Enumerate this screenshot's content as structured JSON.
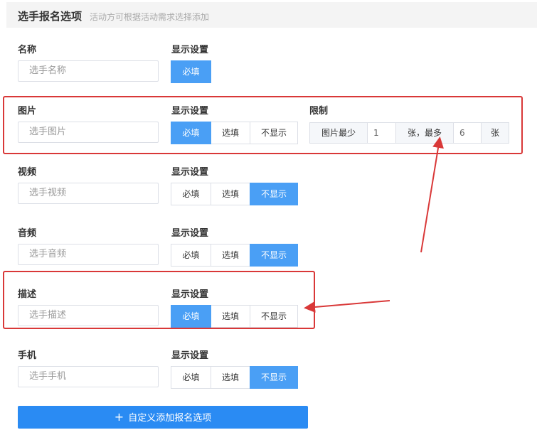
{
  "header": {
    "title": "选手报名选项",
    "subtitle": "活动方可根据活动需求选择添加"
  },
  "setting_label": "显示设置",
  "fields": [
    {
      "label": "名称",
      "placeholder": "选手名称",
      "options": [
        "必填"
      ],
      "selected": "必填"
    },
    {
      "label": "图片",
      "placeholder": "选手图片",
      "options": [
        "必填",
        "选填",
        "不显示"
      ],
      "selected": "必填"
    },
    {
      "label": "视频",
      "placeholder": "选手视频",
      "options": [
        "必填",
        "选填",
        "不显示"
      ],
      "selected": "不显示"
    },
    {
      "label": "音频",
      "placeholder": "选手音频",
      "options": [
        "必填",
        "选填",
        "不显示"
      ],
      "selected": "不显示"
    },
    {
      "label": "描述",
      "placeholder": "选手描述",
      "options": [
        "必填",
        "选填",
        "不显示"
      ],
      "selected": "必填"
    },
    {
      "label": "手机",
      "placeholder": "选手手机",
      "options": [
        "必填",
        "选填",
        "不显示"
      ],
      "selected": "不显示"
    }
  ],
  "limit": {
    "label": "限制",
    "prefix": "图片最少",
    "min_value": "1",
    "middle": "张，最多",
    "max_value": "6",
    "suffix": "张"
  },
  "add_button": {
    "label": "自定义添加报名选项",
    "icon": "plus-icon"
  },
  "colors": {
    "accent": "#4a9ff5",
    "button": "#2a8bf3",
    "annotation": "#d93838"
  }
}
